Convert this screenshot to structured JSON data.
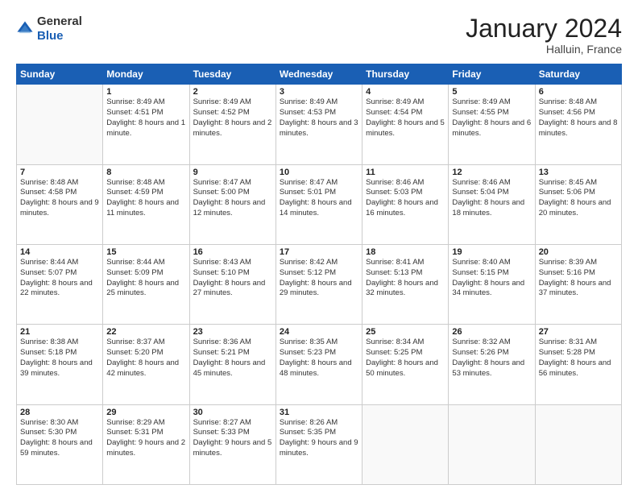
{
  "header": {
    "logo_line1": "General",
    "logo_line2": "Blue",
    "month": "January 2024",
    "location": "Halluin, France"
  },
  "weekdays": [
    "Sunday",
    "Monday",
    "Tuesday",
    "Wednesday",
    "Thursday",
    "Friday",
    "Saturday"
  ],
  "weeks": [
    [
      {
        "day": "",
        "sunrise": "",
        "sunset": "",
        "daylight": ""
      },
      {
        "day": "1",
        "sunrise": "Sunrise: 8:49 AM",
        "sunset": "Sunset: 4:51 PM",
        "daylight": "Daylight: 8 hours and 1 minute."
      },
      {
        "day": "2",
        "sunrise": "Sunrise: 8:49 AM",
        "sunset": "Sunset: 4:52 PM",
        "daylight": "Daylight: 8 hours and 2 minutes."
      },
      {
        "day": "3",
        "sunrise": "Sunrise: 8:49 AM",
        "sunset": "Sunset: 4:53 PM",
        "daylight": "Daylight: 8 hours and 3 minutes."
      },
      {
        "day": "4",
        "sunrise": "Sunrise: 8:49 AM",
        "sunset": "Sunset: 4:54 PM",
        "daylight": "Daylight: 8 hours and 5 minutes."
      },
      {
        "day": "5",
        "sunrise": "Sunrise: 8:49 AM",
        "sunset": "Sunset: 4:55 PM",
        "daylight": "Daylight: 8 hours and 6 minutes."
      },
      {
        "day": "6",
        "sunrise": "Sunrise: 8:48 AM",
        "sunset": "Sunset: 4:56 PM",
        "daylight": "Daylight: 8 hours and 8 minutes."
      }
    ],
    [
      {
        "day": "7",
        "sunrise": "Sunrise: 8:48 AM",
        "sunset": "Sunset: 4:58 PM",
        "daylight": "Daylight: 8 hours and 9 minutes."
      },
      {
        "day": "8",
        "sunrise": "Sunrise: 8:48 AM",
        "sunset": "Sunset: 4:59 PM",
        "daylight": "Daylight: 8 hours and 11 minutes."
      },
      {
        "day": "9",
        "sunrise": "Sunrise: 8:47 AM",
        "sunset": "Sunset: 5:00 PM",
        "daylight": "Daylight: 8 hours and 12 minutes."
      },
      {
        "day": "10",
        "sunrise": "Sunrise: 8:47 AM",
        "sunset": "Sunset: 5:01 PM",
        "daylight": "Daylight: 8 hours and 14 minutes."
      },
      {
        "day": "11",
        "sunrise": "Sunrise: 8:46 AM",
        "sunset": "Sunset: 5:03 PM",
        "daylight": "Daylight: 8 hours and 16 minutes."
      },
      {
        "day": "12",
        "sunrise": "Sunrise: 8:46 AM",
        "sunset": "Sunset: 5:04 PM",
        "daylight": "Daylight: 8 hours and 18 minutes."
      },
      {
        "day": "13",
        "sunrise": "Sunrise: 8:45 AM",
        "sunset": "Sunset: 5:06 PM",
        "daylight": "Daylight: 8 hours and 20 minutes."
      }
    ],
    [
      {
        "day": "14",
        "sunrise": "Sunrise: 8:44 AM",
        "sunset": "Sunset: 5:07 PM",
        "daylight": "Daylight: 8 hours and 22 minutes."
      },
      {
        "day": "15",
        "sunrise": "Sunrise: 8:44 AM",
        "sunset": "Sunset: 5:09 PM",
        "daylight": "Daylight: 8 hours and 25 minutes."
      },
      {
        "day": "16",
        "sunrise": "Sunrise: 8:43 AM",
        "sunset": "Sunset: 5:10 PM",
        "daylight": "Daylight: 8 hours and 27 minutes."
      },
      {
        "day": "17",
        "sunrise": "Sunrise: 8:42 AM",
        "sunset": "Sunset: 5:12 PM",
        "daylight": "Daylight: 8 hours and 29 minutes."
      },
      {
        "day": "18",
        "sunrise": "Sunrise: 8:41 AM",
        "sunset": "Sunset: 5:13 PM",
        "daylight": "Daylight: 8 hours and 32 minutes."
      },
      {
        "day": "19",
        "sunrise": "Sunrise: 8:40 AM",
        "sunset": "Sunset: 5:15 PM",
        "daylight": "Daylight: 8 hours and 34 minutes."
      },
      {
        "day": "20",
        "sunrise": "Sunrise: 8:39 AM",
        "sunset": "Sunset: 5:16 PM",
        "daylight": "Daylight: 8 hours and 37 minutes."
      }
    ],
    [
      {
        "day": "21",
        "sunrise": "Sunrise: 8:38 AM",
        "sunset": "Sunset: 5:18 PM",
        "daylight": "Daylight: 8 hours and 39 minutes."
      },
      {
        "day": "22",
        "sunrise": "Sunrise: 8:37 AM",
        "sunset": "Sunset: 5:20 PM",
        "daylight": "Daylight: 8 hours and 42 minutes."
      },
      {
        "day": "23",
        "sunrise": "Sunrise: 8:36 AM",
        "sunset": "Sunset: 5:21 PM",
        "daylight": "Daylight: 8 hours and 45 minutes."
      },
      {
        "day": "24",
        "sunrise": "Sunrise: 8:35 AM",
        "sunset": "Sunset: 5:23 PM",
        "daylight": "Daylight: 8 hours and 48 minutes."
      },
      {
        "day": "25",
        "sunrise": "Sunrise: 8:34 AM",
        "sunset": "Sunset: 5:25 PM",
        "daylight": "Daylight: 8 hours and 50 minutes."
      },
      {
        "day": "26",
        "sunrise": "Sunrise: 8:32 AM",
        "sunset": "Sunset: 5:26 PM",
        "daylight": "Daylight: 8 hours and 53 minutes."
      },
      {
        "day": "27",
        "sunrise": "Sunrise: 8:31 AM",
        "sunset": "Sunset: 5:28 PM",
        "daylight": "Daylight: 8 hours and 56 minutes."
      }
    ],
    [
      {
        "day": "28",
        "sunrise": "Sunrise: 8:30 AM",
        "sunset": "Sunset: 5:30 PM",
        "daylight": "Daylight: 8 hours and 59 minutes."
      },
      {
        "day": "29",
        "sunrise": "Sunrise: 8:29 AM",
        "sunset": "Sunset: 5:31 PM",
        "daylight": "Daylight: 9 hours and 2 minutes."
      },
      {
        "day": "30",
        "sunrise": "Sunrise: 8:27 AM",
        "sunset": "Sunset: 5:33 PM",
        "daylight": "Daylight: 9 hours and 5 minutes."
      },
      {
        "day": "31",
        "sunrise": "Sunrise: 8:26 AM",
        "sunset": "Sunset: 5:35 PM",
        "daylight": "Daylight: 9 hours and 9 minutes."
      },
      {
        "day": "",
        "sunrise": "",
        "sunset": "",
        "daylight": ""
      },
      {
        "day": "",
        "sunrise": "",
        "sunset": "",
        "daylight": ""
      },
      {
        "day": "",
        "sunrise": "",
        "sunset": "",
        "daylight": ""
      }
    ]
  ]
}
